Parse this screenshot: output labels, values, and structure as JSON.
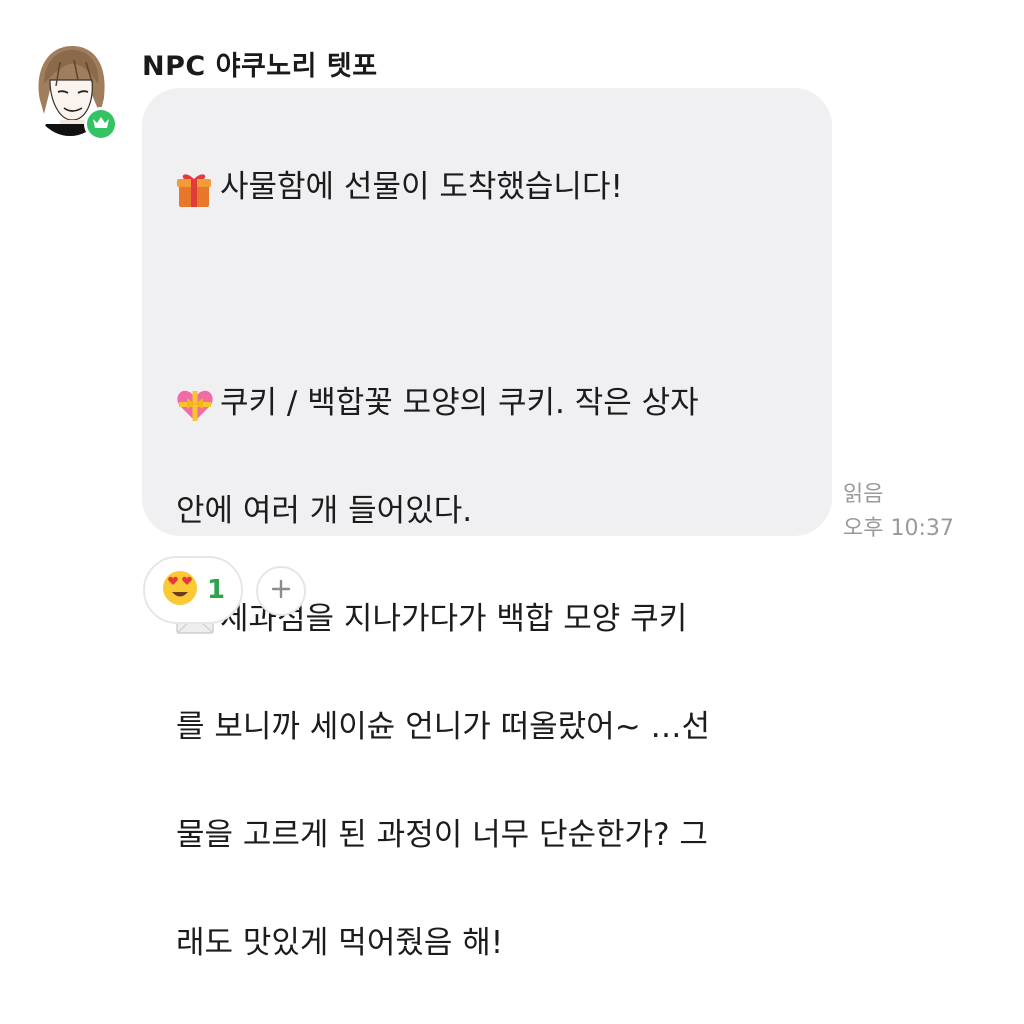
{
  "message": {
    "sender_name": "NPC 야쿠노리 텟포",
    "lines": [
      {
        "emoji": "gift-icon",
        "text": "사물함에 선물이 도착했습니다!"
      },
      {
        "emoji": "",
        "text": ""
      },
      {
        "emoji": "heart-ribbon-icon",
        "text": "쿠키 / 백합꽃 모양의 쿠키. 작은 상자"
      },
      {
        "emoji": "",
        "text": "안에 여러 개 들어있다."
      },
      {
        "emoji": "envelope-icon",
        "text": "제과점을 지나가다가 백합 모양 쿠키"
      },
      {
        "emoji": "",
        "text": "를 보니까 세이슌 언니가 떠올랐어~ …선"
      },
      {
        "emoji": "",
        "text": "물을 고르게 된 과정이 너무 단순한가? 그"
      },
      {
        "emoji": "",
        "text": "래도 맛있게 먹어줬음 해!"
      }
    ],
    "read_status": "읽음",
    "timestamp": "오후 10:37"
  },
  "reactions": {
    "emoji": "heart-eyes-icon",
    "count": "1",
    "add_label": "+"
  },
  "colors": {
    "bubble": "#f0f0f3",
    "badge": "#33c365",
    "count": "#2ea44f"
  }
}
